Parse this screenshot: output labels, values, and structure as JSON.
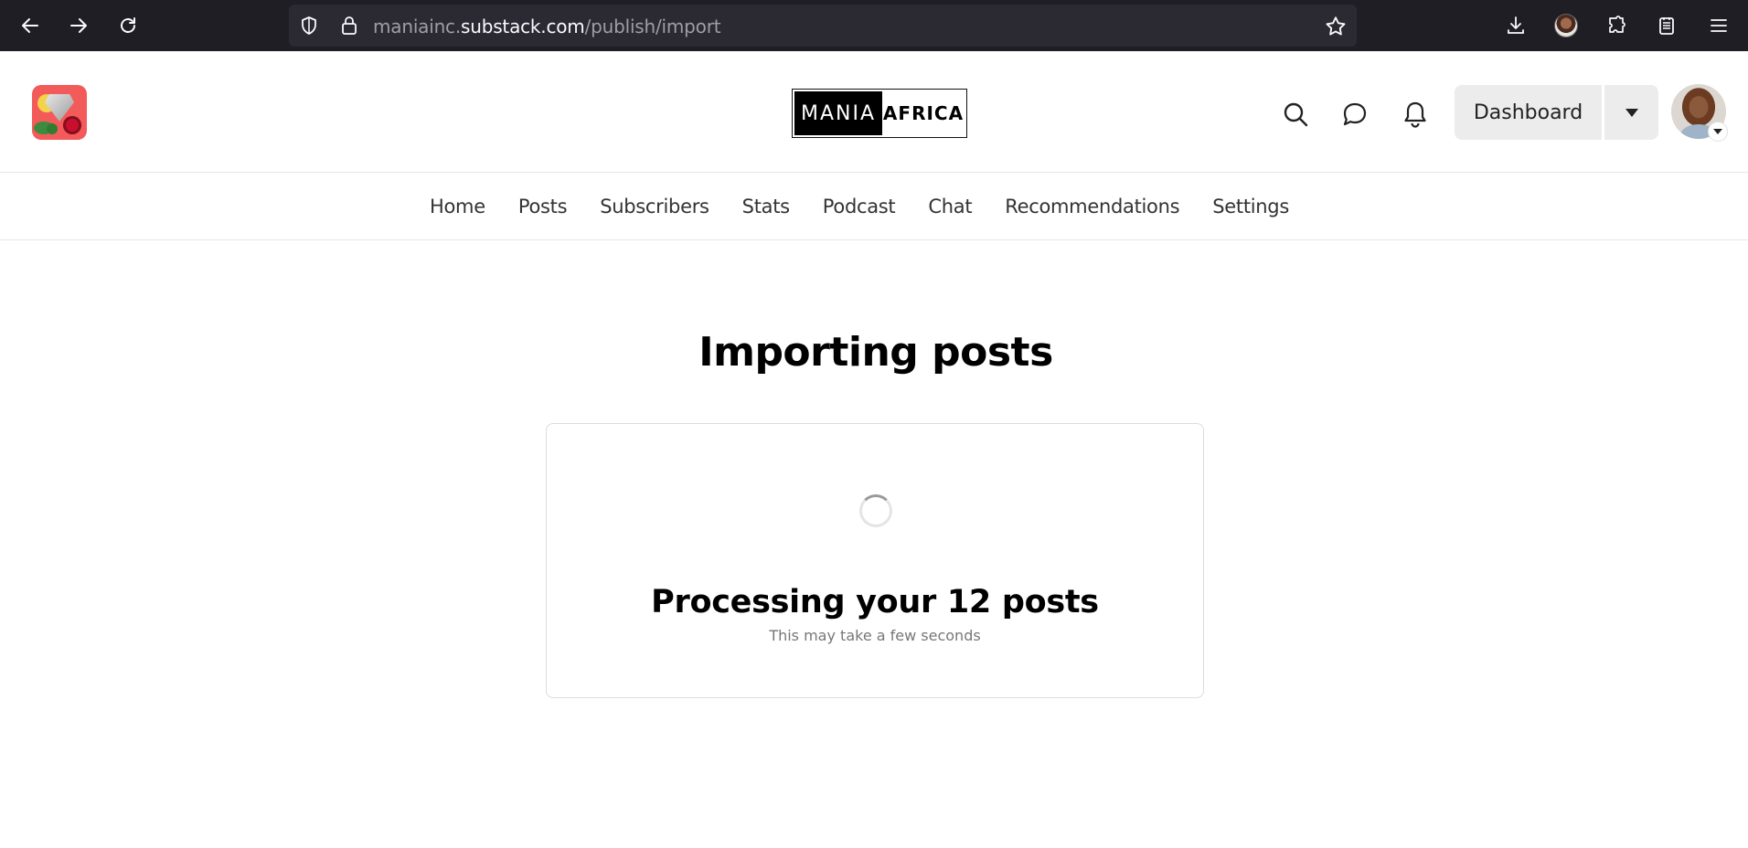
{
  "browser": {
    "url_prefix": "maniainc.",
    "url_host": "substack.com",
    "url_path": "/publish/import"
  },
  "header": {
    "wordmark_left": "MANIA",
    "wordmark_right": "AFRICA",
    "dashboard_label": "Dashboard"
  },
  "nav": {
    "items": [
      {
        "label": "Home"
      },
      {
        "label": "Posts"
      },
      {
        "label": "Subscribers"
      },
      {
        "label": "Stats"
      },
      {
        "label": "Podcast"
      },
      {
        "label": "Chat"
      },
      {
        "label": "Recommendations"
      },
      {
        "label": "Settings"
      }
    ]
  },
  "main": {
    "title": "Importing posts",
    "card_heading": "Processing your 12 posts",
    "card_subtext": "This may take a few seconds"
  },
  "colors": {
    "browser_bg": "#1f1e25",
    "urlbar_bg": "#2b2a33",
    "logo_bg": "#f35a5a",
    "button_bg": "#ececec"
  }
}
